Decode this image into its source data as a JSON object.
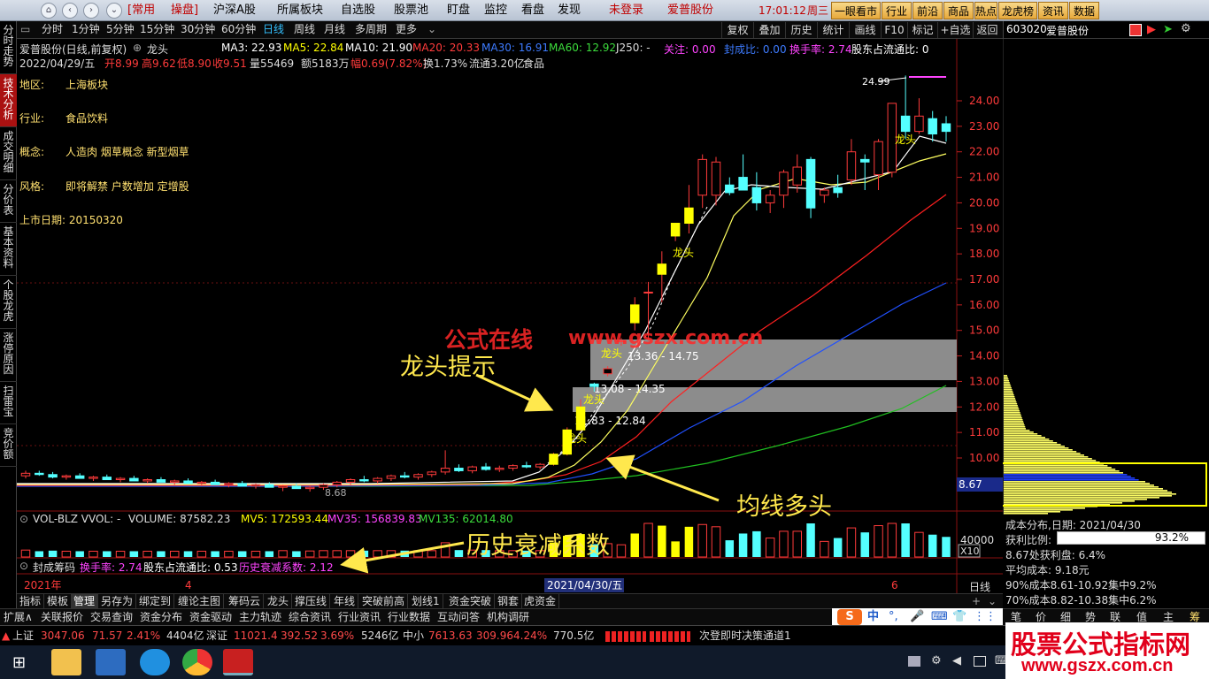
{
  "menubar": {
    "items": [
      "[常用",
      "操盘]",
      "沪深A股",
      "所属板块",
      "自选股",
      "股票池",
      "盯盘",
      "监控",
      "看盘",
      "发现"
    ],
    "login_label": "未登录",
    "stock_name": "爱普股份",
    "time": "17:01:12",
    "weekday": "周三",
    "right_buttons": [
      "一眼看市",
      "行业",
      "前沿",
      "商品",
      "热点",
      "龙虎榜",
      "资讯",
      "数据"
    ]
  },
  "left_tabs": [
    "分时走势",
    "技术分析",
    "成交明细",
    "分价表",
    "基本资料",
    "个股龙虎",
    "涨停原因",
    "扫雷宝",
    "竞价额"
  ],
  "period_tabs": [
    "分时",
    "1分钟",
    "5分钟",
    "15分钟",
    "30分钟",
    "60分钟",
    "日线",
    "周线",
    "月线",
    "多周期",
    "更多"
  ],
  "period_active": "日线",
  "toolbar_right": [
    "复权",
    "叠加",
    "历史",
    "统计",
    "画线",
    "F10",
    "标记",
    "+自选",
    "返回"
  ],
  "right_header": {
    "code": "603020",
    "name": "爱普股份"
  },
  "chart_info": {
    "title": "爱普股份(日线,前复权)",
    "indicator": "龙头",
    "ma": {
      "ma3": "MA3: 22.93",
      "ma5": "MA5: 22.84",
      "ma10": "MA10: 21.90",
      "ma20": "MA20: 20.33",
      "ma30": "MA30: 16.91",
      "ma60": "MA60: 12.92",
      "j250": "J250: -"
    },
    "guanzhu": "关注: 0.00",
    "fengcheng": "封成比: 0.00",
    "huanshou": "换手率: 2.74",
    "gudong": "股东占流通比: 0.53",
    "line2": {
      "date": "2022/04/29/五",
      "open": "开8.99",
      "high": "高9.62",
      "low": "低8.90",
      "close": "收9.51",
      "vol": "量55469",
      "amt": "额5183万",
      "chg": "幅0.69(7.82%)",
      "turn": "换1.73%",
      "float": "流通3.20亿",
      "sector": "食品"
    }
  },
  "stock_meta": [
    {
      "label": "地区:",
      "value": "上海板块"
    },
    {
      "label": "行业:",
      "value": "食品饮料"
    },
    {
      "label": "概念:",
      "value": "人造肉 烟草概念 新型烟草"
    },
    {
      "label": "风格:",
      "value": "即将解禁 户数增加 定增股"
    }
  ],
  "listing_date": "上市日期: 20150320",
  "price_axis": [
    "24.00",
    "23.00",
    "22.00",
    "21.00",
    "20.00",
    "19.00",
    "18.00",
    "17.00",
    "16.00",
    "15.00",
    "14.00",
    "13.00",
    "12.00",
    "11.00",
    "10.00"
  ],
  "current_price_label": "8.67",
  "peak_label": "24.99",
  "low_label": "8.68",
  "zones": [
    "13.36 - 14.75",
    "13.08 - 14.35",
    "11.83 - 12.84"
  ],
  "dragon_labels": [
    "龙头",
    "龙头",
    "龙头",
    "龙头",
    "龙头"
  ],
  "volume_info": {
    "name": "VOL-BLZ VVOL: -",
    "volume": "VOLUME: 87582.23",
    "mv5": "MV5: 172593.44",
    "mv35": "MV35: 156839.83",
    "mv135": "MV135: 62014.80",
    "axis_label": "40000",
    "x10": "X10"
  },
  "seal_info": {
    "name": "封成筹码",
    "turnover": "换手率: 2.74",
    "holder": "股东占流通比: 0.53",
    "decay": "历史衰减系数: 2.12"
  },
  "date_axis": {
    "year": "2021年",
    "m4": "4",
    "selected": "2021/04/30/五",
    "m6": "6",
    "period": "日线"
  },
  "cost_dist": {
    "title": "成本分布,日期: 2021/04/30",
    "profit_label": "获利比例:",
    "profit_value": "93.2%",
    "profit_ratio": 0.932,
    "at_price": "8.67处获利盘: 6.4%",
    "avg_cost": "平均成本: 9.18元",
    "c90": "90%成本8.61-10.92集中9.2%",
    "c70": "70%成本8.82-10.38集中6.2%"
  },
  "bottom_tabs": [
    "指标",
    "模板",
    "管理",
    "另存为",
    "绑定到",
    "缠论主图",
    "筹码云",
    "龙头",
    "撑压线",
    "年线",
    "突破前高",
    "划线1",
    "资金突破",
    "钢套",
    "虎资金"
  ],
  "bottom_active": "管理",
  "ext_tabs": [
    "扩展∧",
    "关联报价",
    "交易查询",
    "资金分布",
    "资金驱动",
    "主力轨迹",
    "综合资讯",
    "行业资讯",
    "行业数据",
    "互动问答",
    "机构调研"
  ],
  "right_tabs": [
    "笔",
    "价",
    "细",
    "势",
    "联",
    "值",
    "主",
    "筹"
  ],
  "status": {
    "sh": "上证",
    "sh_val": "3047.06",
    "sh_chg": "71.57",
    "sh_pct": "2.41%",
    "sh_amt": "4404亿",
    "sz": "深证",
    "sz_val": "11021.4",
    "sz_chg": "392.52",
    "sz_pct": "3.69%",
    "sz_amt": "5246亿",
    "zx": "中小",
    "zx_val": "7613.63",
    "zx_chg": "309.96",
    "zx_pct": "4.24%",
    "zx_amt": "770.5亿",
    "news": "次登即时决策通道1"
  },
  "ime": [
    "中",
    "°,",
    "🎤",
    "⌨",
    "👕",
    "⋮⋮"
  ],
  "watermark": {
    "cn": "公式在线",
    "url": "www.gszx.com.cn"
  },
  "annotations": {
    "dragon": "龙头提示",
    "ma": "均线多头",
    "decay": "历史衰减系数"
  },
  "brand": {
    "title": "股票公式指标网",
    "url": "www.gszx.com.cn"
  },
  "colors": {
    "up": "#ff3b3b",
    "down": "#54ffff",
    "yellow": "#ffff00",
    "ma10_white": "#ffffff",
    "ma20_red": "#ff2020",
    "ma30_blue": "#2050ff",
    "ma60_green": "#20c020",
    "magenta": "#ff44ff"
  },
  "chart_data": {
    "type": "candlestick",
    "price_range": [
      8.0,
      25.0
    ],
    "candles": [
      [
        9.3,
        9.5,
        9.2,
        9.4
      ],
      [
        9.4,
        9.5,
        9.3,
        9.35
      ],
      [
        9.35,
        9.45,
        9.2,
        9.25
      ],
      [
        9.25,
        9.35,
        9.15,
        9.3
      ],
      [
        9.3,
        9.4,
        9.2,
        9.2
      ],
      [
        9.2,
        9.3,
        9.1,
        9.25
      ],
      [
        9.25,
        9.35,
        9.15,
        9.15
      ],
      [
        9.15,
        9.25,
        9.05,
        9.2
      ],
      [
        9.2,
        9.3,
        9.1,
        9.1
      ],
      [
        9.1,
        9.2,
        9.0,
        9.15
      ],
      [
        9.15,
        9.25,
        9.05,
        9.05
      ],
      [
        9.05,
        9.15,
        8.95,
        9.1
      ],
      [
        9.1,
        9.2,
        9.0,
        9.0
      ],
      [
        9.0,
        9.1,
        8.9,
        9.05
      ],
      [
        9.05,
        9.15,
        8.95,
        8.95
      ],
      [
        8.95,
        9.05,
        8.85,
        9.0
      ],
      [
        9.0,
        9.1,
        8.9,
        8.9
      ],
      [
        8.9,
        9.0,
        8.8,
        8.95
      ],
      [
        8.95,
        9.05,
        8.85,
        8.85
      ],
      [
        8.85,
        8.95,
        8.7,
        8.9
      ],
      [
        8.9,
        9.0,
        8.8,
        8.8
      ],
      [
        8.8,
        8.9,
        8.68,
        8.85
      ],
      [
        8.85,
        9.0,
        8.75,
        8.95
      ],
      [
        8.95,
        9.1,
        8.85,
        9.05
      ],
      [
        9.05,
        9.2,
        8.95,
        9.15
      ],
      [
        9.15,
        9.3,
        9.05,
        9.1
      ],
      [
        9.1,
        9.25,
        9.0,
        9.2
      ],
      [
        9.2,
        9.35,
        9.1,
        9.3
      ],
      [
        9.3,
        9.45,
        9.2,
        9.25
      ],
      [
        9.25,
        9.4,
        9.15,
        9.35
      ],
      [
        9.35,
        9.5,
        9.25,
        9.45
      ],
      [
        9.45,
        10.3,
        9.35,
        9.6
      ],
      [
        9.6,
        9.75,
        9.45,
        9.5
      ],
      [
        9.5,
        9.7,
        9.4,
        9.65
      ],
      [
        9.65,
        9.8,
        9.5,
        9.55
      ],
      [
        9.55,
        9.7,
        9.45,
        9.6
      ],
      [
        9.6,
        9.75,
        9.5,
        9.7
      ],
      [
        9.7,
        9.85,
        9.6,
        9.65
      ],
      [
        9.65,
        9.8,
        9.55,
        9.75
      ],
      [
        9.75,
        10.2,
        9.7,
        10.15
      ],
      [
        10.15,
        11.2,
        10.1,
        11.1
      ],
      [
        11.1,
        12.3,
        11.05,
        12.0
      ],
      [
        12.9,
        12.95,
        12.6,
        12.8
      ],
      [
        13.3,
        13.6,
        13.2,
        13.5
      ],
      [
        14.6,
        14.7,
        14.4,
        14.6
      ],
      [
        15.3,
        16.3,
        15.0,
        16.0
      ],
      [
        16.5,
        16.9,
        14.6,
        16.5
      ],
      [
        17.2,
        18.1,
        16.1,
        17.6
      ],
      [
        18.7,
        19.1,
        18.5,
        19.2
      ],
      [
        19.2,
        20.7,
        18.8,
        19.8
      ],
      [
        20.3,
        21.9,
        19.8,
        21.7
      ],
      [
        20.3,
        21.8,
        19.9,
        21.6
      ],
      [
        20.7,
        21.0,
        20.3,
        20.4
      ],
      [
        21.0,
        21.9,
        20.6,
        20.5
      ],
      [
        20.6,
        21.2,
        19.7,
        20.0
      ],
      [
        20.0,
        20.5,
        19.6,
        20.3
      ],
      [
        20.3,
        21.3,
        19.8,
        21.2
      ],
      [
        20.7,
        21.9,
        20.4,
        21.4
      ],
      [
        21.7,
        21.8,
        19.4,
        19.8
      ],
      [
        20.3,
        20.6,
        20.0,
        20.5
      ],
      [
        20.6,
        21.1,
        20.2,
        20.4
      ],
      [
        20.9,
        22.5,
        20.7,
        22.0
      ],
      [
        21.7,
        21.9,
        20.5,
        21.6
      ],
      [
        21.1,
        22.5,
        20.5,
        22.4
      ],
      [
        21.2,
        23.9,
        21.0,
        23.9
      ],
      [
        23.4,
        24.99,
        22.5,
        22.8
      ],
      [
        22.8,
        24.1,
        22.7,
        23.4
      ],
      [
        23.3,
        23.6,
        22.4,
        22.7
      ],
      [
        23.1,
        23.4,
        22.4,
        22.8
      ]
    ]
  }
}
